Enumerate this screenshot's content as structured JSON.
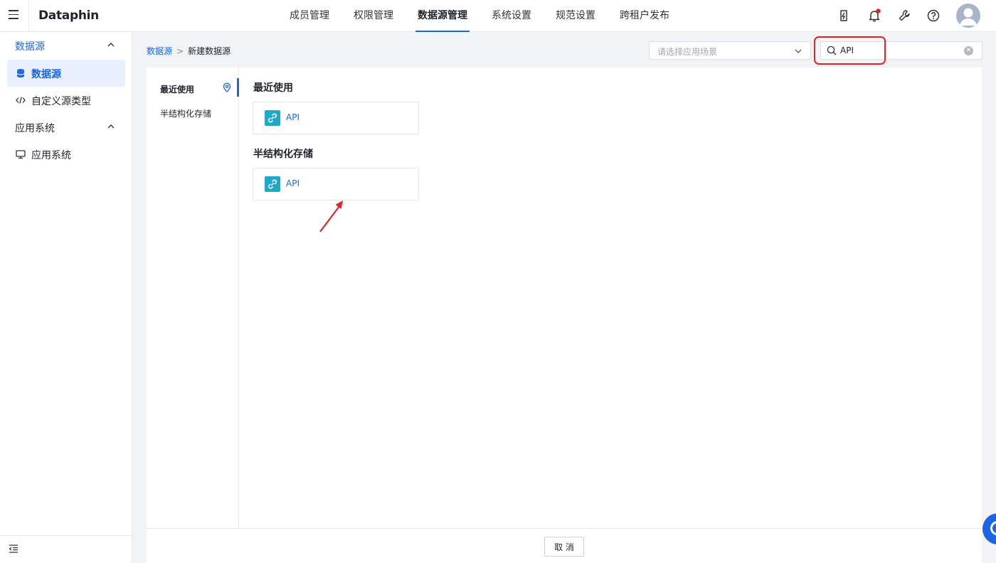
{
  "app": {
    "brand": "Dataphin"
  },
  "top_nav": {
    "items": [
      {
        "label": "成员管理",
        "active": false
      },
      {
        "label": "权限管理",
        "active": false
      },
      {
        "label": "数据源管理",
        "active": true
      },
      {
        "label": "系统设置",
        "active": false
      },
      {
        "label": "规范设置",
        "active": false
      },
      {
        "label": "跨租户发布",
        "active": false
      }
    ],
    "icons": [
      "lightning-badge-icon",
      "bell-icon",
      "wrench-icon",
      "help-icon",
      "avatar"
    ],
    "notification_dot_color": "#e02424"
  },
  "sidebar": {
    "groups": [
      {
        "label": "数据源",
        "active": true,
        "expanded": true
      },
      {
        "label": "应用系统",
        "active": false,
        "expanded": true
      }
    ],
    "items": [
      {
        "label": "数据源",
        "icon": "database-icon",
        "active": true
      },
      {
        "label": "自定义源类型",
        "icon": "code-icon",
        "active": false
      },
      {
        "label": "应用系统",
        "icon": "monitor-icon",
        "active": false
      }
    ]
  },
  "breadcrumb": {
    "parent": "数据源",
    "separator": ">",
    "current": "新建数据源"
  },
  "filters": {
    "scene_placeholder": "请选择应用场景",
    "search_value": "API"
  },
  "categories": [
    {
      "label": "最近使用",
      "active": true
    },
    {
      "label": "半结构化存储",
      "active": false
    }
  ],
  "sections": [
    {
      "title": "最近使用",
      "cards": [
        {
          "name": "API",
          "icon": "link-icon"
        }
      ]
    },
    {
      "title": "半结构化存储",
      "cards": [
        {
          "name": "API",
          "icon": "link-icon"
        }
      ]
    }
  ],
  "footer": {
    "cancel_label": "取 消"
  },
  "colors": {
    "accent": "#1b66e8",
    "highlight": "#e02424",
    "api_logo": "#20a8c8"
  }
}
